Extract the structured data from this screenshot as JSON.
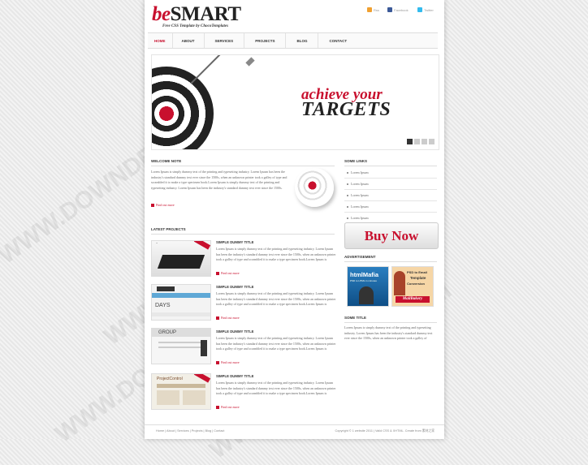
{
  "brand": {
    "be": "be",
    "smart": "SMART",
    "tagline": "Free CSS Template by ChocoTemplates"
  },
  "social": [
    {
      "label": "Rss",
      "color": "#f0a030",
      "icon": "rss-icon"
    },
    {
      "label": "Facebook",
      "color": "#3b5998",
      "icon": "facebook-icon"
    },
    {
      "label": "Twitter",
      "color": "#33bbee",
      "icon": "twitter-icon"
    }
  ],
  "nav": [
    "HOME",
    "ABOUT",
    "SERVICES",
    "PROJECTS",
    "BLOG",
    "CONTACT"
  ],
  "banner": {
    "line1": "achieve your",
    "line2": "TARGETS"
  },
  "welcome": {
    "title": "WELCOME NOTE",
    "text": "Lorem Ipsum is simply dummy text of the printing and typesetting industry. Lorem Ipsum has been the industry's standard dummy text ever since the 1500s, when an unknown printer took a galley of type and scrambled it to make a type specimen book.Lorem Ipsum is simply dummy text of the printing and typesetting industry. Lorem Ipsum has been the industry's standard dummy text ever since the 1500s.",
    "more": "Find out more"
  },
  "projects": {
    "title": "LATEST PROJECTS",
    "items": [
      {
        "title": "SIMPLE DUMMY TITLE",
        "text": "Lorem Ipsum is simply dummy text of the printing and typesetting industry. Lorem Ipsum has been the industry's standard dummy text ever since the 1500s, when an unknown printer took a galley of type and scrambled it to make a type specimen book.Lorem Ipsum is",
        "more": "Find out more"
      },
      {
        "title": "SIMPLE DUMMY TITLE",
        "text": "Lorem Ipsum is simply dummy text of the printing and typesetting industry. Lorem Ipsum has been the industry's standard dummy text ever since the 1500s, when an unknown printer took a galley of type and scrambled it to make a type specimen book.Lorem Ipsum is",
        "more": "Find out more"
      },
      {
        "title": "SIMPLE DUMMY TITLE",
        "text": "Lorem Ipsum is simply dummy text of the printing and typesetting industry. Lorem Ipsum has been the industry's standard dummy text ever since the 1500s, when an unknown printer took a galley of type and scrambled it to make a type specimen book.Lorem Ipsum is",
        "more": "Find out more"
      },
      {
        "title": "SIMPLE DUMMY TITLE",
        "text": "Lorem Ipsum is simply dummy text of the printing and typesetting industry. Lorem Ipsum has been the industry's standard dummy text ever since the 1500s, when an unknown printer took a galley of type and scrambled it to make a type specimen book.Lorem Ipsum is",
        "more": "Find out more"
      }
    ]
  },
  "some_links": {
    "title": "SOME LINKS",
    "items": [
      "Lorem Ipsum",
      "Lorem Ipsum",
      "Lorem Ipsum",
      "Lorem Ipsum",
      "Lorem Ipsum",
      "Lorem Ipsum"
    ]
  },
  "buy_now": "Buy Now",
  "advertisement": {
    "title": "ADVERTISEMENT",
    "ad1": {
      "brand": "htmlMafia",
      "sub": "PSD to HTML in minutes"
    },
    "ad2": {
      "line1": "PSD to Email",
      "line2": "Template",
      "line3": "Conversion",
      "brand": "MailBakery"
    }
  },
  "some_title": {
    "title": "SOME TITLE",
    "text": "Lorem Ipsum is simply dummy text of the printing and typesetting industry. Lorem Ipsum has been the industry's standard dummy text ever since the 1500s, when an unknown printer took a galley of"
  },
  "footer": {
    "links": [
      "Home",
      "About",
      "Services",
      "Projects",
      "Blog",
      "Contact"
    ],
    "copyright": "Copyright © 1 website 2011 | Valid CSS & XHTML. Create from 素材之家"
  },
  "watermark": "WWW.DOWNDEMO.COM"
}
